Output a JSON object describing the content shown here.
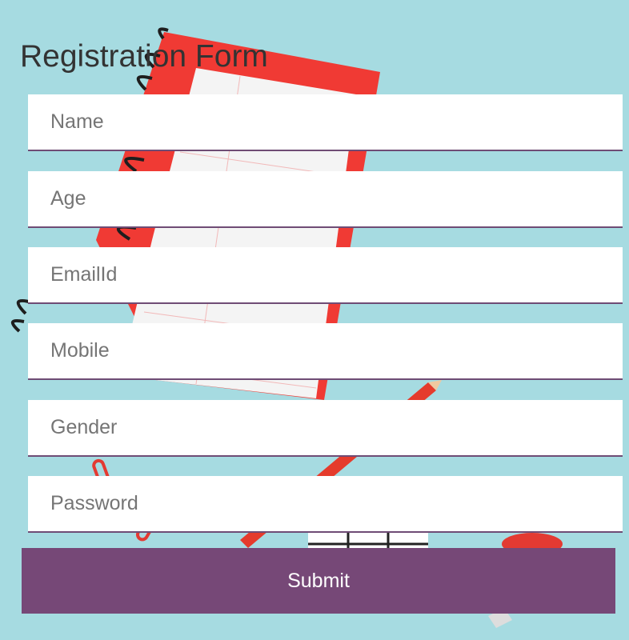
{
  "form": {
    "title": "Registration Form",
    "fields": [
      {
        "placeholder": "Name",
        "value": ""
      },
      {
        "placeholder": "Age",
        "value": ""
      },
      {
        "placeholder": "EmailId",
        "value": ""
      },
      {
        "placeholder": "Mobile",
        "value": ""
      },
      {
        "placeholder": "Gender",
        "value": ""
      },
      {
        "placeholder": "Password",
        "value": ""
      }
    ],
    "submit_label": "Submit"
  },
  "colors": {
    "background": "#a6dbe1",
    "accent": "#764877",
    "field_border": "#6f4c75",
    "field_background": "#ffffff",
    "notebook_cover": "#f03a34"
  }
}
